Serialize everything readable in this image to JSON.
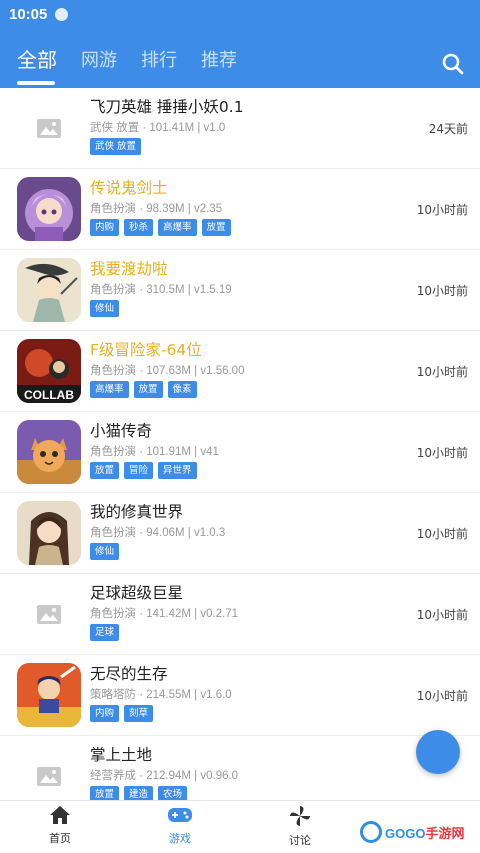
{
  "statusbar": {
    "time": "10:05"
  },
  "tabs": [
    {
      "label": "全部",
      "active": true
    },
    {
      "label": "网游",
      "active": false
    },
    {
      "label": "排行",
      "active": false
    },
    {
      "label": "推荐",
      "active": false
    }
  ],
  "games": [
    {
      "title": "飞刀英雄 捶捶小妖0.1",
      "meta": "武侠 放置 · 101.41M | v1.0",
      "tags": [
        "武侠 放置"
      ],
      "time": "24天前",
      "icon": "placeholder-image-icon",
      "highlight": false
    },
    {
      "title": "传说鬼剑士",
      "meta": "角色扮演 · 98.39M | v2.35",
      "tags": [
        "内购",
        "秒杀",
        "高爆率",
        "放置"
      ],
      "time": "10小时前",
      "icon": "game-icon-anime-girl",
      "highlight": true
    },
    {
      "title": "我要渡劫啦",
      "meta": "角色扮演 · 310.5M | v1.5.19",
      "tags": [
        "修仙"
      ],
      "time": "10小时前",
      "icon": "game-icon-ink-cultivator",
      "highlight": true
    },
    {
      "title": "F级冒险家-64位",
      "meta": "角色扮演 · 107.63M | v1.56.00",
      "tags": [
        "高爆率",
        "放置",
        "像素"
      ],
      "time": "10小时前",
      "icon": "game-icon-collab",
      "highlight": true
    },
    {
      "title": "小猫传奇",
      "meta": "角色扮演 · 101.91M | v41",
      "tags": [
        "放置",
        "冒险",
        "异世界"
      ],
      "time": "10小时前",
      "icon": "game-icon-cat-warrior",
      "highlight": false
    },
    {
      "title": "我的修真世界",
      "meta": "角色扮演 · 94.06M | v1.0.3",
      "tags": [
        "修仙"
      ],
      "time": "10小时前",
      "icon": "game-icon-cultivator-girl",
      "highlight": false
    },
    {
      "title": "足球超级巨星",
      "meta": "角色扮演 · 141.42M | v0.2.71",
      "tags": [
        "足球"
      ],
      "time": "10小时前",
      "icon": "placeholder-image-icon",
      "highlight": false
    },
    {
      "title": "无尽的生存",
      "meta": "策略塔防 · 214.55M | v1.6.0",
      "tags": [
        "内购",
        "刻草"
      ],
      "time": "10小时前",
      "icon": "game-icon-survivor",
      "highlight": false
    },
    {
      "title": "掌上土地",
      "meta": "经营养成 · 212.94M | v0.96.0",
      "tags": [
        "放置",
        "建造",
        "农场"
      ],
      "time": "",
      "icon": "placeholder-image-icon",
      "highlight": false
    }
  ],
  "bottomnav": [
    {
      "label": "首页",
      "icon": "home-icon",
      "active": false
    },
    {
      "label": "游戏",
      "icon": "gamepad-icon",
      "active": true
    },
    {
      "label": "讨论",
      "icon": "pinwheel-icon",
      "active": false
    }
  ],
  "watermark": {
    "prefix": "GOGO",
    "suffix": "手游网"
  },
  "colors": {
    "primary": "#3d8ce8",
    "highlight": "#e8b120"
  }
}
